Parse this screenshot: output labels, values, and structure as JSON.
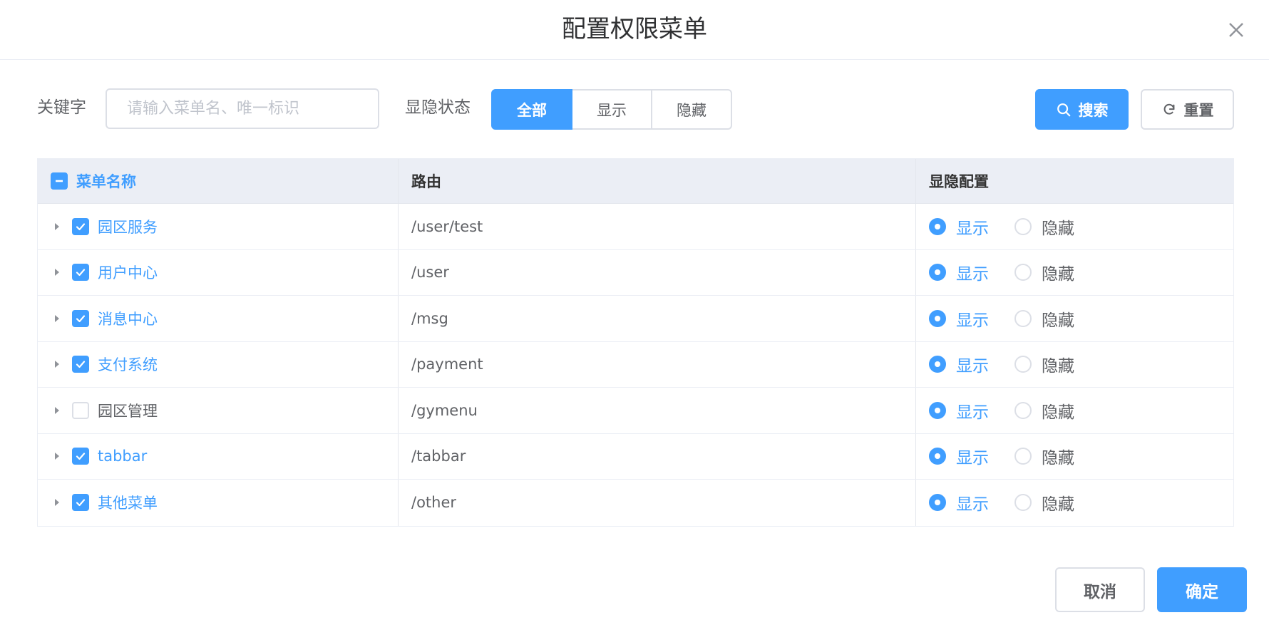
{
  "dialog": {
    "title": "配置权限菜单"
  },
  "filter": {
    "keyword_label": "关键字",
    "keyword_placeholder": "请输入菜单名、唯一标识",
    "keyword_value": "",
    "state_label": "显隐状态",
    "state_options": [
      "全部",
      "显示",
      "隐藏"
    ],
    "state_selected": "全部",
    "search_label": "搜索",
    "reset_label": "重置"
  },
  "table": {
    "headers": {
      "name": "菜单名称",
      "route": "路由",
      "visibility": "显隐配置"
    },
    "header_checkbox_state": "indeterminate",
    "radio_labels": {
      "show": "显示",
      "hide": "隐藏"
    },
    "rows": [
      {
        "name": "园区服务",
        "route": "/user/test",
        "checked": true,
        "visibility": "显示"
      },
      {
        "name": "用户中心",
        "route": "/user",
        "checked": true,
        "visibility": "显示"
      },
      {
        "name": "消息中心",
        "route": "/msg",
        "checked": true,
        "visibility": "显示"
      },
      {
        "name": "支付系统",
        "route": "/payment",
        "checked": true,
        "visibility": "显示"
      },
      {
        "name": "园区管理",
        "route": "/gymenu",
        "checked": false,
        "visibility": "显示"
      },
      {
        "name": "tabbar",
        "route": "/tabbar",
        "checked": true,
        "visibility": "显示"
      },
      {
        "name": "其他菜单",
        "route": "/other",
        "checked": true,
        "visibility": "显示"
      }
    ]
  },
  "footer": {
    "cancel_label": "取消",
    "confirm_label": "确定"
  },
  "colors": {
    "primary": "#409eff",
    "border": "#dcdfe6",
    "header_bg": "#ebeef5"
  }
}
